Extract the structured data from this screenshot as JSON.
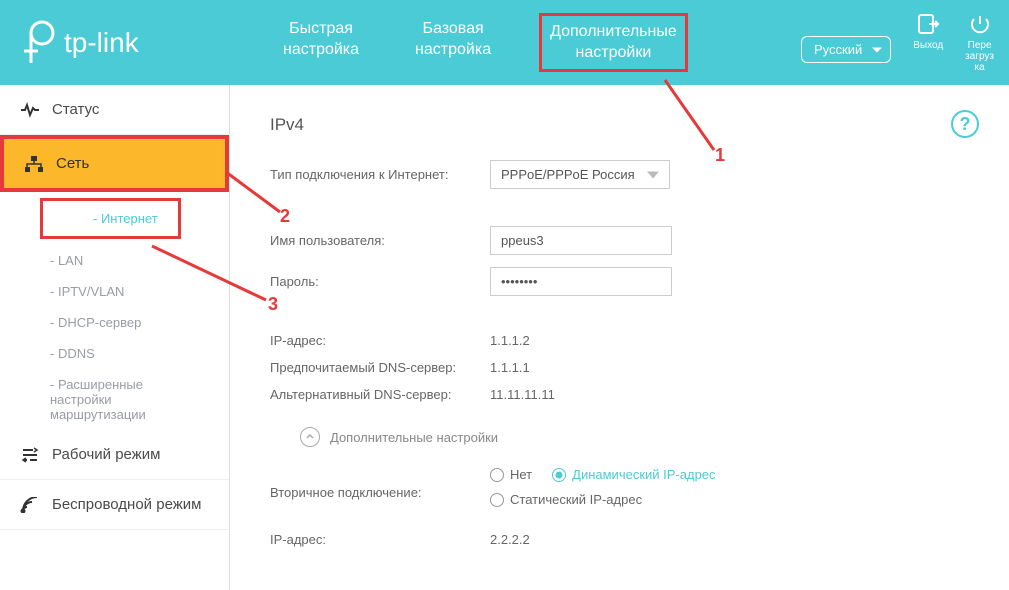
{
  "header": {
    "brand": "tp-link",
    "tabs": {
      "quick": "Быстрая\nнастройка",
      "basic": "Базовая\nнастройка",
      "advanced": "Дополнительные\nнастройки"
    },
    "language": "Русский",
    "logout": "Выход",
    "reboot": "Пере\nзагруз\nка"
  },
  "sidebar": {
    "status": "Статус",
    "network": "Сеть",
    "network_subs": {
      "internet": "Интернет",
      "lan": "LAN",
      "iptv": "IPTV/VLAN",
      "dhcp": "DHCP-сервер",
      "ddns": "DDNS",
      "routing": "Расширенные настройки маршрутизации"
    },
    "mode": "Рабочий режим",
    "wireless": "Беспроводной режим"
  },
  "content": {
    "title": "IPv4",
    "conn_type_label": "Тип подключения к Интернет:",
    "conn_type_value": "PPPoE/PPPoE Россия",
    "username_label": "Имя пользователя:",
    "username_value": "ppeus3",
    "password_label": "Пароль:",
    "password_value": "••••••••",
    "ip_label": "IP-адрес:",
    "ip_value": "1.1.1.2",
    "dns1_label": "Предпочитаемый DNS-сервер:",
    "dns1_value": "1.1.1.1",
    "dns2_label": "Альтернативный DNS-сервер:",
    "dns2_value": "11.11.11.11",
    "expand_label": "Дополнительные настройки",
    "secondary_label": "Вторичное подключение:",
    "radio_none": "Нет",
    "radio_dynamic": "Динамический IP-адрес",
    "radio_static": "Статический IP-адрес",
    "ip2_label": "IP-адрес:",
    "ip2_value": "2.2.2.2"
  },
  "annotations": {
    "one": "1",
    "two": "2",
    "three": "3"
  }
}
